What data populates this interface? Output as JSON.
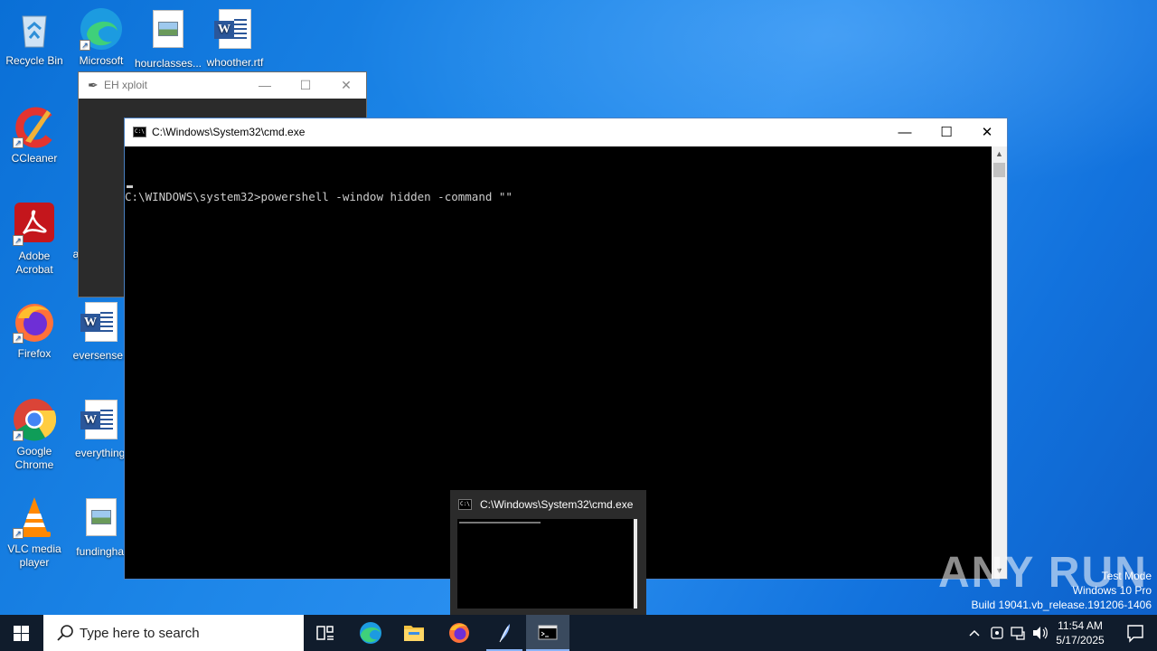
{
  "desktop": {
    "icons": [
      {
        "label": "Recycle Bin"
      },
      {
        "label": "Microsoft Edge"
      },
      {
        "label": "hourclasses..."
      },
      {
        "label": "whoother.rtf"
      },
      {
        "label": "CCleaner"
      },
      {
        "label": "Adobe Acrobat"
      },
      {
        "label": "a"
      },
      {
        "label": "Firefox"
      },
      {
        "label": "eversense.r"
      },
      {
        "label": "Google Chrome"
      },
      {
        "label": "everythingl"
      },
      {
        "label": "VLC media player"
      },
      {
        "label": "fundinghal"
      }
    ]
  },
  "eh_window": {
    "title": "EH xploit",
    "minimize": "—",
    "maximize": "☐",
    "close": "✕"
  },
  "cmd_window": {
    "title": "C:\\Windows\\System32\\cmd.exe",
    "prompt_line": "C:\\WINDOWS\\system32>powershell -window hidden -command \"\"",
    "minimize": "—",
    "maximize": "☐",
    "close": "✕"
  },
  "taskbar_preview": {
    "title": "C:\\Windows\\System32\\cmd.exe"
  },
  "watermark": {
    "brand": "ANY RUN",
    "line1": "Test Mode",
    "line2": "Windows 10 Pro",
    "line3": "Build 19041.vb_release.191206-1406"
  },
  "taskbar": {
    "search_placeholder": "Type here to search",
    "time": "11:54 AM",
    "date": "5/17/2025"
  }
}
